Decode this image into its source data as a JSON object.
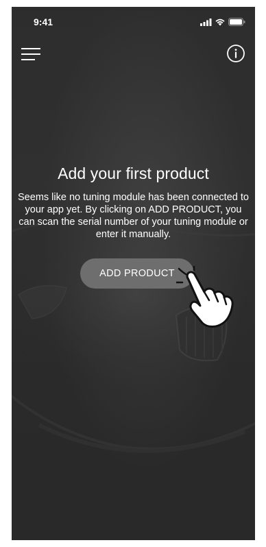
{
  "status_bar": {
    "time": "9:41",
    "icons": [
      "signal-icon",
      "wifi-icon",
      "battery-icon"
    ]
  },
  "nav": {
    "menu_icon": "hamburger-menu-icon",
    "info_icon": "info-icon"
  },
  "empty_state": {
    "title": "Add your first product",
    "description": "Seems like no tuning module has been connected to your app yet. By clicking on ADD PRODUCT, you can scan the serial number of your tuning module or enter it manually.",
    "button_label": "ADD PRODUCT"
  },
  "colors": {
    "background": "#2d2d2d",
    "button_bg": "#6e6e6e",
    "text": "#ffffff"
  }
}
